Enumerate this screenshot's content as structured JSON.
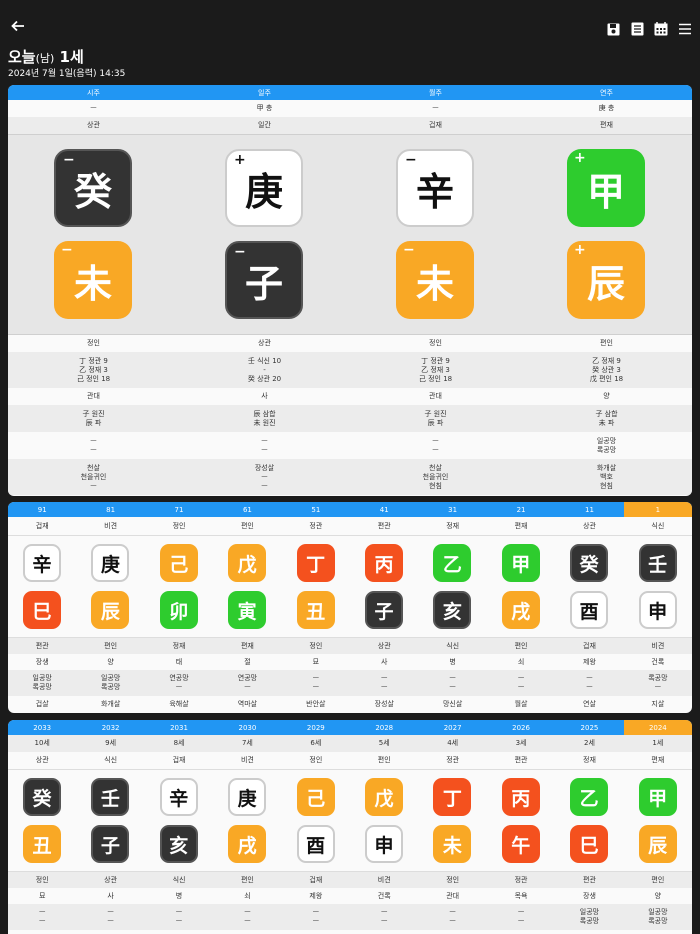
{
  "header": {
    "title_main": "오늘",
    "title_paren": "(남)",
    "title_age": " 1세",
    "subtitle": "2024년 7월 1일(음력) 14:35"
  },
  "pillars": {
    "headers": [
      "시주",
      "일주",
      "월주",
      "연주"
    ],
    "row1": [
      "ㅡ",
      "甲 충",
      "ㅡ",
      "庚 충"
    ],
    "row2": [
      "상관",
      "일간",
      "겁재",
      "편재"
    ],
    "stems": [
      {
        "char": "癸",
        "sign": "−",
        "color": "dark"
      },
      {
        "char": "庚",
        "sign": "+",
        "color": "white"
      },
      {
        "char": "辛",
        "sign": "−",
        "color": "white"
      },
      {
        "char": "甲",
        "sign": "+",
        "color": "green"
      }
    ],
    "branches": [
      {
        "char": "未",
        "sign": "−",
        "color": "orange"
      },
      {
        "char": "子",
        "sign": "−",
        "color": "dark"
      },
      {
        "char": "未",
        "sign": "−",
        "color": "orange"
      },
      {
        "char": "辰",
        "sign": "+",
        "color": "orange"
      }
    ],
    "row3": [
      "정인",
      "상관",
      "정인",
      "편인"
    ],
    "row4": [
      "丁 정관 9\n乙 정재 3\n己 정인 18",
      "壬 식신 10\n-\n癸 상관 20",
      "丁 정관 9\n乙 정재 3\n己 정인 18",
      "乙 정재 9\n癸 상관 3\n戊 편인 18"
    ],
    "row5": [
      "관대",
      "사",
      "관대",
      "양"
    ],
    "row6": [
      "子 원진\n辰 파",
      "辰 삼합\n未 원진",
      "子 원진\n辰 파",
      "子 삼합\n未 파"
    ],
    "row7": [
      "ㅡ\nㅡ",
      "ㅡ\nㅡ",
      "ㅡ\nㅡ",
      "일공망\n록공망"
    ],
    "row8": [
      "천살\n천을귀인\nㅡ",
      "장성살\nㅡ\nㅡ",
      "천살\n천을귀인\n현침",
      "화개살\n백호\n현침"
    ]
  },
  "daewoon": {
    "headers": [
      "91",
      "81",
      "71",
      "61",
      "51",
      "41",
      "31",
      "21",
      "11",
      "1"
    ],
    "row1": [
      "겁재",
      "비견",
      "정인",
      "편인",
      "정관",
      "편관",
      "정재",
      "편재",
      "상관",
      "식신"
    ],
    "stems": [
      {
        "char": "辛",
        "color": "white"
      },
      {
        "char": "庚",
        "color": "white"
      },
      {
        "char": "己",
        "color": "orange"
      },
      {
        "char": "戊",
        "color": "orange"
      },
      {
        "char": "丁",
        "color": "red"
      },
      {
        "char": "丙",
        "color": "red"
      },
      {
        "char": "乙",
        "color": "green"
      },
      {
        "char": "甲",
        "color": "green"
      },
      {
        "char": "癸",
        "color": "dark"
      },
      {
        "char": "壬",
        "color": "dark"
      }
    ],
    "branches": [
      {
        "char": "巳",
        "color": "red"
      },
      {
        "char": "辰",
        "color": "orange"
      },
      {
        "char": "卯",
        "color": "green"
      },
      {
        "char": "寅",
        "color": "green"
      },
      {
        "char": "丑",
        "color": "orange"
      },
      {
        "char": "子",
        "color": "dark"
      },
      {
        "char": "亥",
        "color": "dark"
      },
      {
        "char": "戌",
        "color": "orange"
      },
      {
        "char": "酉",
        "color": "white"
      },
      {
        "char": "申",
        "color": "white"
      }
    ],
    "row2": [
      "편관",
      "편인",
      "정재",
      "편재",
      "정인",
      "상관",
      "식신",
      "편인",
      "겁재",
      "비견"
    ],
    "row3": [
      "장생",
      "양",
      "태",
      "절",
      "묘",
      "사",
      "병",
      "쇠",
      "제왕",
      "건록"
    ],
    "row4": [
      "일공망\n록공망",
      "일공망\n록공망",
      "연공망\nㅡ",
      "연공망\nㅡ",
      "ㅡ\nㅡ",
      "ㅡ\nㅡ",
      "ㅡ\nㅡ",
      "ㅡ\nㅡ",
      "ㅡ\nㅡ",
      "록공망\nㅡ"
    ],
    "row5": [
      "겁살",
      "화개살",
      "육해살",
      "역마살",
      "반안살",
      "장성살",
      "망신살",
      "월살",
      "연살",
      "지살"
    ]
  },
  "seun": {
    "headers": [
      "2033",
      "2032",
      "2031",
      "2030",
      "2029",
      "2028",
      "2027",
      "2026",
      "2025",
      "2024"
    ],
    "row1": [
      "10세",
      "9세",
      "8세",
      "7세",
      "6세",
      "5세",
      "4세",
      "3세",
      "2세",
      "1세"
    ],
    "row2": [
      "상관",
      "식신",
      "겁재",
      "비견",
      "정인",
      "편인",
      "정관",
      "편관",
      "정재",
      "편재"
    ],
    "stems": [
      {
        "char": "癸",
        "color": "dark"
      },
      {
        "char": "壬",
        "color": "dark"
      },
      {
        "char": "辛",
        "color": "white"
      },
      {
        "char": "庚",
        "color": "white"
      },
      {
        "char": "己",
        "color": "orange"
      },
      {
        "char": "戊",
        "color": "orange"
      },
      {
        "char": "丁",
        "color": "red"
      },
      {
        "char": "丙",
        "color": "red"
      },
      {
        "char": "乙",
        "color": "green"
      },
      {
        "char": "甲",
        "color": "green"
      }
    ],
    "branches": [
      {
        "char": "丑",
        "color": "orange"
      },
      {
        "char": "子",
        "color": "dark"
      },
      {
        "char": "亥",
        "color": "dark"
      },
      {
        "char": "戌",
        "color": "orange"
      },
      {
        "char": "酉",
        "color": "white"
      },
      {
        "char": "申",
        "color": "white"
      },
      {
        "char": "未",
        "color": "orange"
      },
      {
        "char": "午",
        "color": "red"
      },
      {
        "char": "巳",
        "color": "red"
      },
      {
        "char": "辰",
        "color": "orange"
      }
    ],
    "row3": [
      "정인",
      "상관",
      "식신",
      "편인",
      "겁재",
      "비견",
      "정인",
      "정관",
      "편관",
      "편인"
    ],
    "row4": [
      "묘",
      "사",
      "병",
      "쇠",
      "제왕",
      "건록",
      "관대",
      "목욕",
      "장생",
      "양"
    ],
    "row5": [
      "ㅡ\nㅡ",
      "ㅡ\nㅡ",
      "ㅡ\nㅡ",
      "ㅡ\nㅡ",
      "ㅡ\nㅡ",
      "ㅡ\nㅡ",
      "ㅡ\nㅡ",
      "ㅡ\nㅡ",
      "일공망\n록공망",
      "일공망\n록공망"
    ]
  }
}
